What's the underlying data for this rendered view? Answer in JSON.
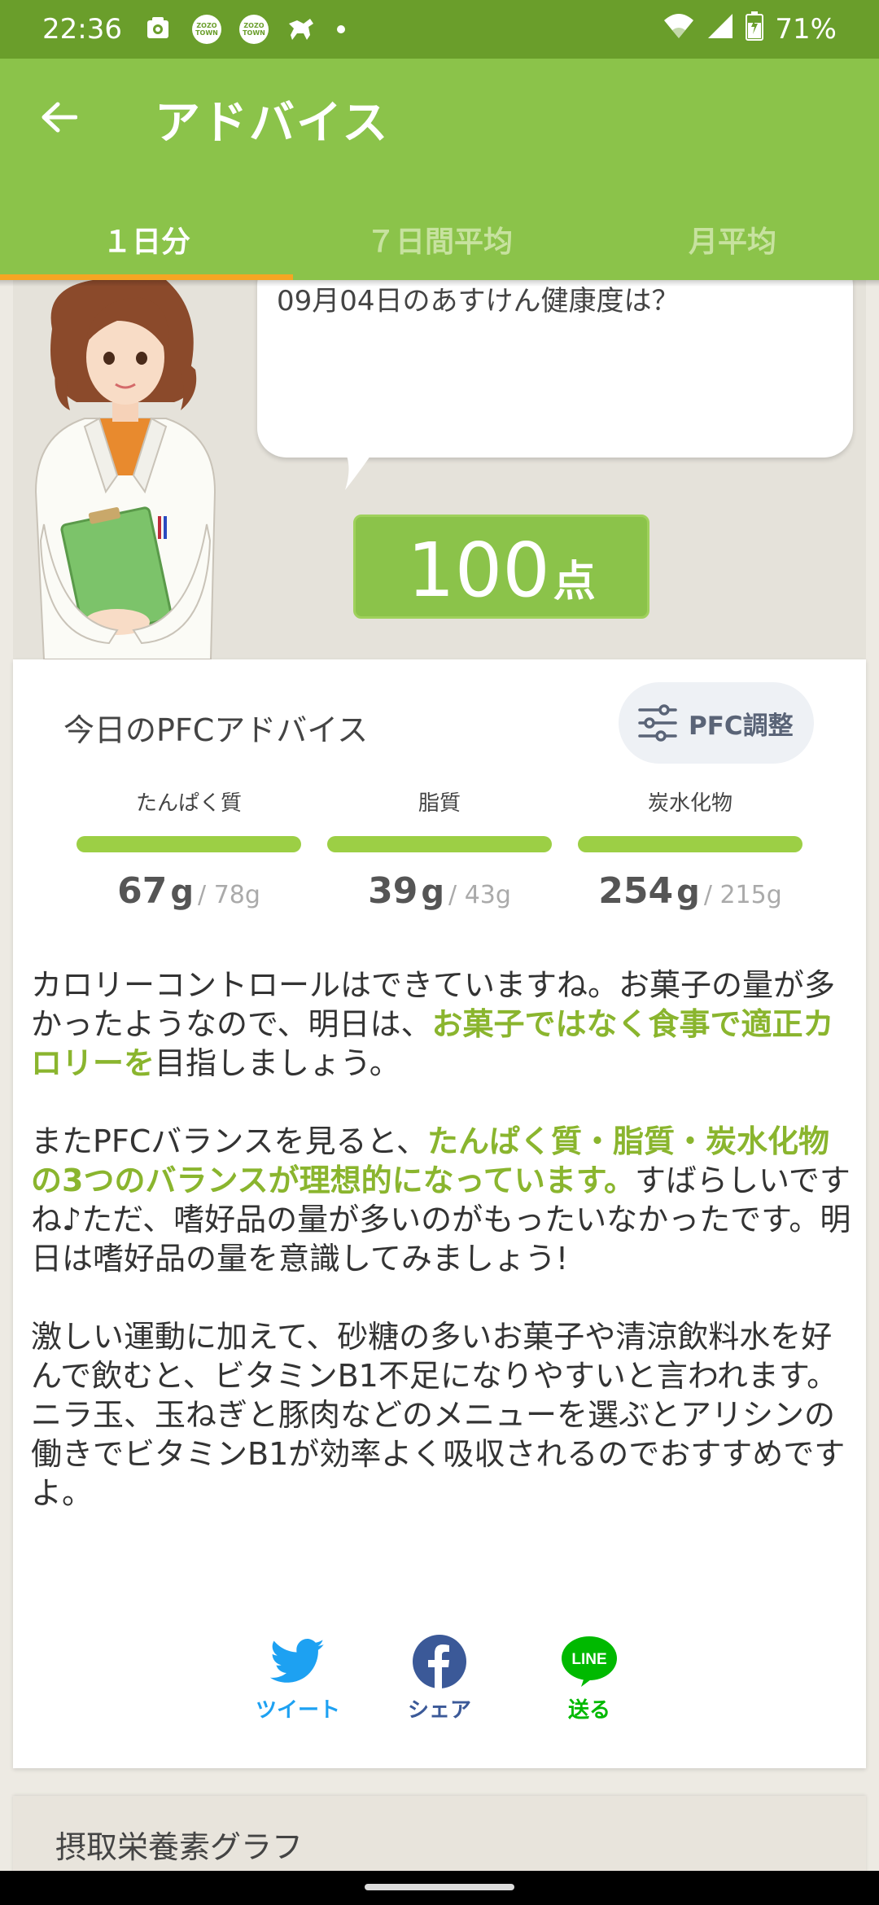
{
  "status": {
    "time": "22:36",
    "battery": "71%",
    "zozo_label": "ZOZO TOWN",
    "icons": [
      "sync-icon",
      "zozo-icon",
      "zozo-icon",
      "horse-icon",
      "dot-icon",
      "wifi-icon",
      "signal-icon",
      "battery-icon"
    ]
  },
  "header": {
    "title": "アドバイス",
    "tabs": [
      {
        "label": "１日分",
        "active": true
      },
      {
        "label": "７日間平均",
        "active": false
      },
      {
        "label": "月平均",
        "active": false
      }
    ]
  },
  "hero": {
    "bubble_text": "09月04日のあすけん健康度は？",
    "score_value": "100",
    "score_unit": "点"
  },
  "pfc": {
    "title": "今日のPFCアドバイス",
    "adjust_label": "PFC調整",
    "items": [
      {
        "label": "たんぱく質",
        "value": "67",
        "unit": "g",
        "target": "/ 78g",
        "progress": 1.0
      },
      {
        "label": "脂質",
        "value": "39",
        "unit": "g",
        "target": "/ 43g",
        "progress": 1.0
      },
      {
        "label": "炭水化物",
        "value": "254",
        "unit": "g",
        "target": "/ 215g",
        "progress": 1.0
      }
    ]
  },
  "advice": {
    "p1_a": "カロリーコントロールはできていますね。お菓子の量が多かったようなので、明日は、",
    "p1_hl": "お菓子ではなく食事で適正カロリーを",
    "p1_b": "目指しましょう。",
    "p2_a": "またPFCバランスを見ると、",
    "p2_hl": "たんぱく質・脂質・炭水化物の3つのバランスが理想的になっています。",
    "p2_b": "すばらしいですね♪ただ、嗜好品の量が多いのがもったいなかったです。明日は嗜好品の量を意識してみましょう!",
    "p3": "激しい運動に加えて、砂糖の多いお菓子や清涼飲料水を好んで飲むと、ビタミンB1不足になりやすいと言われます。ニラ玉、玉ねぎと豚肉などのメニューを選ぶとアリシンの働きでビタミンB1が効率よく吸収されるのでおすすめですよ。"
  },
  "share": {
    "twitter": "ツイート",
    "facebook": "シェア",
    "line": "送る",
    "line_logo": "LINE"
  },
  "next_section": {
    "title": "摂取栄養素グラフ"
  },
  "colors": {
    "status_bar": "#6a9e2b",
    "app_bar": "#8bc34a",
    "tab_indicator": "#f5a623",
    "highlight": "#8ab52e",
    "twitter": "#1da1f2",
    "facebook": "#3b5998",
    "line": "#00b900"
  }
}
